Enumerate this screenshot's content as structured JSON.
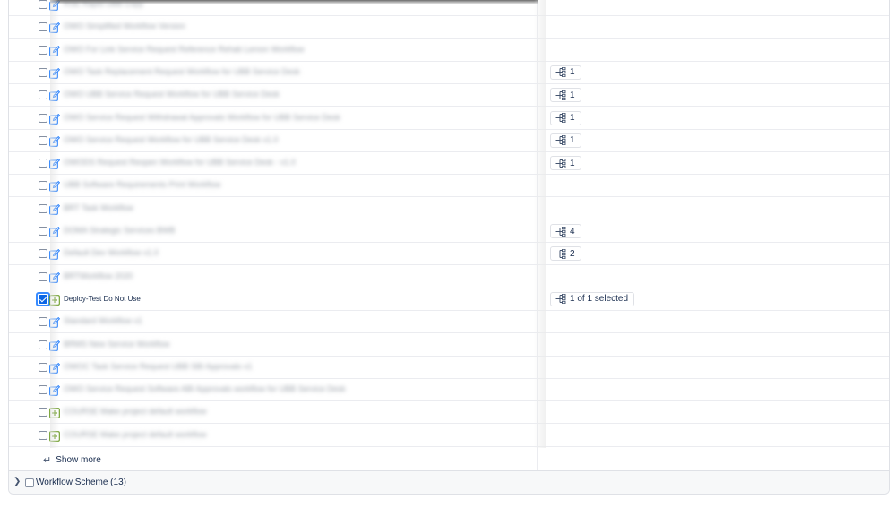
{
  "rows": [
    {
      "label": "RSE Rapid UBB Copy",
      "checked": false,
      "icon": "edit-icon",
      "badge": null
    },
    {
      "label": "OWO Simplified Workflow Version",
      "checked": false,
      "icon": "edit-icon",
      "badge": null
    },
    {
      "label": "OWO For Link Service Request Reference Rehab Lemon Workflow",
      "checked": false,
      "icon": "edit-icon",
      "badge": null
    },
    {
      "label": "OWO Task Replacement Request Workflow for UBB Service Desk",
      "checked": false,
      "icon": "edit-icon",
      "badge": "1"
    },
    {
      "label": "OWO UBB Service Request Workflow for UBB Service Desk",
      "checked": false,
      "icon": "edit-icon",
      "badge": "1"
    },
    {
      "label": "OWO Service Request Withdrawal Approvals Workflow for UBB Service Desk",
      "checked": false,
      "icon": "edit-icon",
      "badge": "1"
    },
    {
      "label": "OWO Service Request Workflow for UBB Service Desk v1.0",
      "checked": false,
      "icon": "edit-icon",
      "badge": "1"
    },
    {
      "label": "OWODS Request Reopen Workflow for UBB Service Desk - v1.0",
      "checked": false,
      "icon": "edit-icon",
      "badge": "1"
    },
    {
      "label": "UBB Software Requirements Print Workflow",
      "checked": false,
      "icon": "edit-icon",
      "badge": null
    },
    {
      "label": "BRT Task Workflow",
      "checked": false,
      "icon": "edit-icon",
      "badge": null
    },
    {
      "label": "DOMA Strategic Services BWB",
      "checked": false,
      "icon": "edit-icon",
      "badge": "4"
    },
    {
      "label": "Default Dev Workflow v1.0",
      "checked": false,
      "icon": "edit-icon",
      "badge": "2"
    },
    {
      "label": "BRTWorkflow 2020",
      "checked": false,
      "icon": "edit-icon",
      "badge": null
    },
    {
      "label": "Deploy-Test Do Not Use",
      "checked": true,
      "icon": "add-square-icon",
      "badge": "1 of 1 selected",
      "clear": true
    },
    {
      "label": "Standard Workflow v1",
      "checked": false,
      "icon": "edit-icon",
      "badge": null
    },
    {
      "label": "BRMS New Service Workflow",
      "checked": false,
      "icon": "edit-icon",
      "badge": null
    },
    {
      "label": "OWOC Task Service Request UBB SBI Approvals v1",
      "checked": false,
      "icon": "edit-icon",
      "badge": null
    },
    {
      "label": "OWO Service Request Software ABI Approvals workflow for UBB Service Desk",
      "checked": false,
      "icon": "edit-icon",
      "badge": null
    },
    {
      "label": "COURSE Make project default workflow",
      "checked": false,
      "icon": "add-square-icon",
      "badge": null
    },
    {
      "label": "COURSE Make project default workflow",
      "checked": false,
      "icon": "add-square-icon",
      "badge": null
    }
  ],
  "show_more_label": "Show more",
  "footer": {
    "label": "Workflow Scheme (13)"
  },
  "colors": {
    "accent": "#0c66e4",
    "edit": "#1d7afc",
    "add": "#6a9a23"
  }
}
